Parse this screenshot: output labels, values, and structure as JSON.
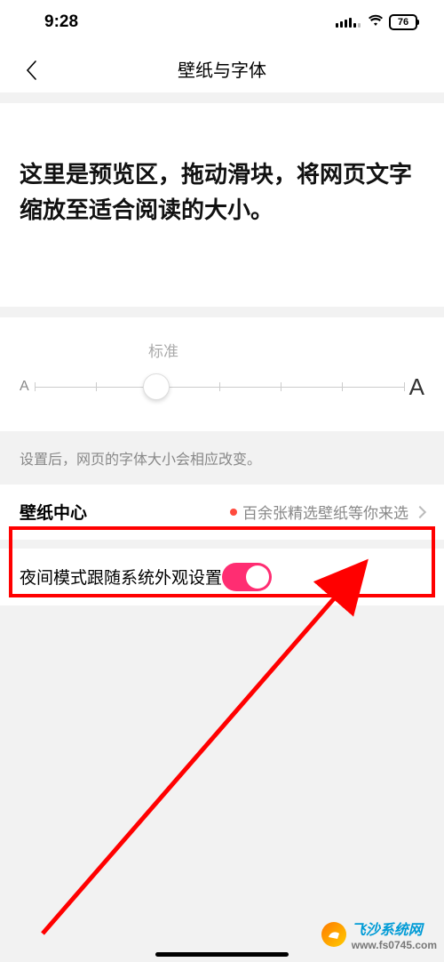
{
  "status": {
    "time": "9:28",
    "battery": "76"
  },
  "nav": {
    "title": "壁纸与字体"
  },
  "preview": {
    "text": "这里是预览区，拖动滑块，将网页文字缩放至适合阅读的大小。"
  },
  "slider": {
    "label": "标准",
    "small_letter": "A",
    "large_letter": "A",
    "position_pct": 33,
    "tick_count": 7
  },
  "hint": "设置后，网页的字体大小会相应改变。",
  "wallpaper_row": {
    "title": "壁纸中心",
    "promo": "百余张精选壁纸等你来选"
  },
  "night_row": {
    "title": "夜间模式跟随系统外观设置",
    "enabled": true
  },
  "watermark": {
    "name": "飞沙系统网",
    "url": "www.fs0745.com"
  }
}
